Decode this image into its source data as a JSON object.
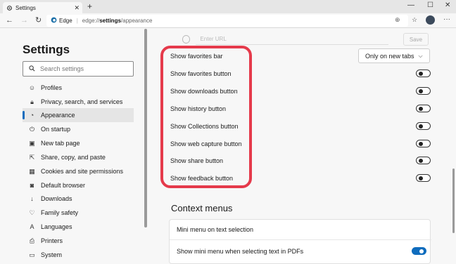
{
  "browser": {
    "tab_title": "Settings",
    "new_tab": "+",
    "tab_close": "✕",
    "window_controls": {
      "minimize": "—",
      "maximize": "☐",
      "close": "✕"
    },
    "address": {
      "brand": "Edge",
      "url_prefix": "edge://",
      "url_bold": "settings",
      "url_suffix": "/appearance"
    }
  },
  "sidebar": {
    "heading": "Settings",
    "search_placeholder": "Search settings",
    "items": [
      {
        "label": "Profiles",
        "icon": "profile-icon"
      },
      {
        "label": "Privacy, search, and services",
        "icon": "lock-icon"
      },
      {
        "label": "Appearance",
        "icon": "appearance-icon",
        "active": true
      },
      {
        "label": "On startup",
        "icon": "power-icon"
      },
      {
        "label": "New tab page",
        "icon": "newtab-icon"
      },
      {
        "label": "Share, copy, and paste",
        "icon": "share-icon"
      },
      {
        "label": "Cookies and site permissions",
        "icon": "cookie-icon"
      },
      {
        "label": "Default browser",
        "icon": "browser-icon"
      },
      {
        "label": "Downloads",
        "icon": "download-icon"
      },
      {
        "label": "Family safety",
        "icon": "family-icon"
      },
      {
        "label": "Languages",
        "icon": "language-icon"
      },
      {
        "label": "Printers",
        "icon": "printer-icon"
      },
      {
        "label": "System",
        "icon": "laptop-icon"
      }
    ]
  },
  "main": {
    "url_placeholder": "Enter URL",
    "save_label": "Save",
    "favorites_bar_label": "Show favorites bar",
    "favorites_bar_value": "Only on new tabs",
    "toolbar_buttons": [
      {
        "label": "Show favorites button",
        "on": false
      },
      {
        "label": "Show downloads button",
        "on": false
      },
      {
        "label": "Show history button",
        "on": false
      },
      {
        "label": "Show Collections button",
        "on": false
      },
      {
        "label": "Show web capture button",
        "on": false
      },
      {
        "label": "Show share button",
        "on": false
      },
      {
        "label": "Show feedback button",
        "on": false
      }
    ],
    "context_menus_title": "Context menus",
    "mini_menu_label": "Mini menu on text selection",
    "mini_menu_pdf_label": "Show mini menu when selecting text in PDFs",
    "mini_menu_pdf_on": true
  },
  "colors": {
    "accent": "#0f6cbd",
    "highlight": "#e53a4b"
  }
}
